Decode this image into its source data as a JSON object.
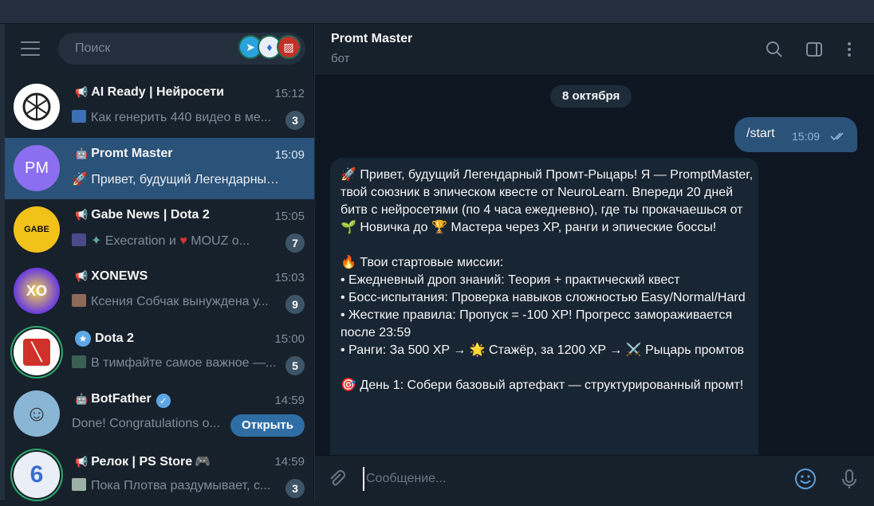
{
  "sidebar": {
    "search_placeholder": "Поиск",
    "chats": [
      {
        "title": "AI Ready | Нейросети",
        "time": "15:12",
        "preview": "Как генерить 440 видео в ме...",
        "badge": "3"
      },
      {
        "title": "Promt Master",
        "time": "15:09",
        "preview": "Привет, будущий Легендарный ...",
        "avatar_text": "PM"
      },
      {
        "title": "Gabe News | Dota 2",
        "time": "15:05",
        "preview": "Execration и",
        "preview2": "MOUZ о...",
        "badge": "7"
      },
      {
        "title": "XONEWS",
        "time": "15:03",
        "preview": "Ксения Собчак вынуждена у...",
        "badge": "9"
      },
      {
        "title": "Dota 2",
        "time": "15:00",
        "preview": "В тимфайте самое важное —...",
        "badge": "5"
      },
      {
        "title": "BotFather",
        "time": "14:59",
        "preview": "Done! Congratulations o...",
        "button": "Открыть"
      },
      {
        "title": "Релок | PS Store",
        "time": "14:59",
        "preview": "Пока Плотва раздумывает, с...",
        "badge": "3"
      }
    ]
  },
  "chat": {
    "title": "Promt Master",
    "subtitle": "бот",
    "date": "8 октября",
    "out_message": {
      "text": "/start",
      "time": "15:09"
    },
    "in_message": "🚀 Привет, будущий Легендарный Промт-Рыцарь! Я — PromptMaster, твой союзник в эпическом квесте от NeuroLearn. Впереди 20 дней битв с нейросетями (по 4 часа ежедневно), где ты прокачаешься от 🌱 Новичка до 🏆 Мастера через XP, ранги и эпические боссы!\n\n🔥 Твои стартовые миссии:\n• Ежедневный дроп знаний: Теория + практический квест\n• Босс-испытания: Проверка навыков сложностью Easy/Normal/Hard\n• Жесткие правила: Пропуск = -100 XP! Прогресс замораживается после 23:59\n• Ранги: За 500 XP → 🌟 Стажёр, за 1200 XP → ⚔️ Рыцарь промтов\n\n🎯 День 1: Собери базовый артефакт — структурированный промт!",
    "composer_placeholder": "Сообщение..."
  },
  "colors": {
    "accent": "#2b5278",
    "badge": "#3e5467",
    "background": "#0e1621",
    "panel": "#17212b"
  }
}
